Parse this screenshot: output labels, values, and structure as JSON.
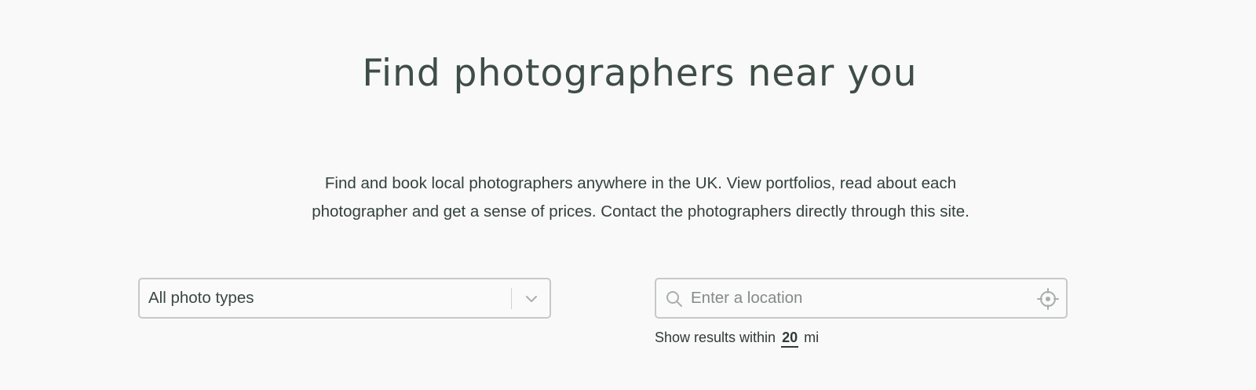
{
  "header": {
    "title": "Find photographers near you"
  },
  "intro": {
    "line1": "Find and book local photographers anywhere in the UK. View portfolios, read about each",
    "line2": "photographer and get a sense of prices. Contact the photographers directly through this site."
  },
  "filters": {
    "photo_type": {
      "selected": "All photo types",
      "icon": "chevron-down-icon"
    },
    "location": {
      "placeholder": "Enter a location",
      "value": "",
      "search_icon": "search-icon",
      "locate_icon": "crosshair-locate-icon"
    },
    "radius": {
      "prefix": "Show results within",
      "value": "20",
      "unit": "mi"
    }
  },
  "colors": {
    "background": "#f9f9f9",
    "text": "#3d4a45",
    "border": "#c6c9c8",
    "icon": "#a9aeac"
  }
}
